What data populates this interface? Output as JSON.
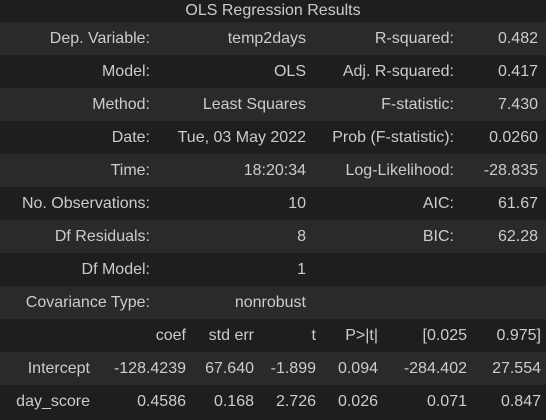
{
  "caption": "OLS Regression Results",
  "summary_rows": [
    [
      "Dep. Variable:",
      "temp2days",
      "R-squared:",
      "0.482"
    ],
    [
      "Model:",
      "OLS",
      "Adj. R-squared:",
      "0.417"
    ],
    [
      "Method:",
      "Least Squares",
      "F-statistic:",
      "7.430"
    ],
    [
      "Date:",
      "Tue, 03 May 2022",
      "Prob (F-statistic):",
      "0.0260"
    ],
    [
      "Time:",
      "18:20:34",
      "Log-Likelihood:",
      "-28.835"
    ],
    [
      "No. Observations:",
      "10",
      "AIC:",
      "61.67"
    ],
    [
      "Df Residuals:",
      "8",
      "BIC:",
      "62.28"
    ],
    [
      "Df Model:",
      "1",
      "",
      ""
    ],
    [
      "Covariance Type:",
      "nonrobust",
      "",
      ""
    ]
  ],
  "coef_header": [
    "",
    "coef",
    "std err",
    "t",
    "P>|t|",
    "[0.025",
    "0.975]"
  ],
  "coef_rows": [
    [
      "Intercept",
      "-128.4239",
      "67.640",
      "-1.899",
      "0.094",
      "-284.402",
      "27.554"
    ],
    [
      "day_score",
      "0.4586",
      "0.168",
      "2.726",
      "0.026",
      "0.071",
      "0.847"
    ]
  ]
}
